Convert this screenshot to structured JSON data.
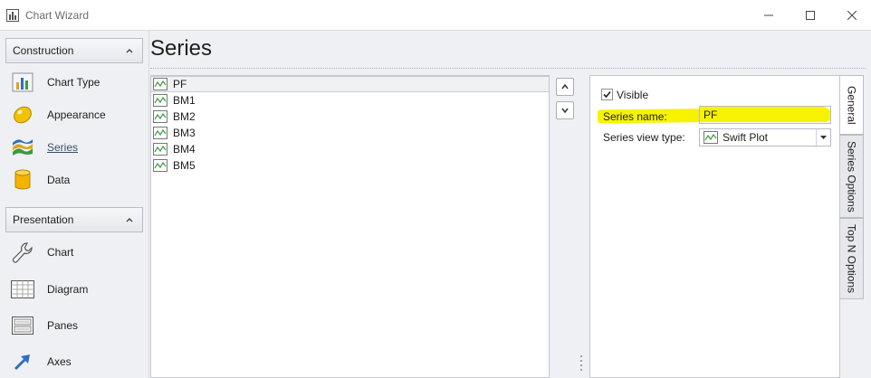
{
  "window": {
    "title": "Chart Wizard",
    "icon": "chart-wizard-icon"
  },
  "sidebar": {
    "groups": [
      {
        "label": "Construction",
        "items": [
          {
            "label": "Chart Type",
            "icon": "chart-type-icon"
          },
          {
            "label": "Appearance",
            "icon": "appearance-icon"
          },
          {
            "label": "Series",
            "icon": "series-icon",
            "active": true
          },
          {
            "label": "Data",
            "icon": "data-icon"
          }
        ]
      },
      {
        "label": "Presentation",
        "items": [
          {
            "label": "Chart",
            "icon": "wrench-icon"
          },
          {
            "label": "Diagram",
            "icon": "diagram-icon"
          },
          {
            "label": "Panes",
            "icon": "panes-icon"
          },
          {
            "label": "Axes",
            "icon": "axes-icon"
          }
        ]
      }
    ]
  },
  "main": {
    "title": "Series",
    "series_list": [
      {
        "name": "PF",
        "selected": true
      },
      {
        "name": "BM1"
      },
      {
        "name": "BM2"
      },
      {
        "name": "BM3"
      },
      {
        "name": "BM4"
      },
      {
        "name": "BM5"
      }
    ]
  },
  "properties": {
    "visible_label": "Visible",
    "visible_checked": true,
    "series_name_label": "Series name:",
    "series_name_value": "PF",
    "view_type_label": "Series view type:",
    "view_type_value": "Swift Plot"
  },
  "tabs": [
    {
      "label": "General",
      "active": true
    },
    {
      "label": "Series Options"
    },
    {
      "label": "Top N Options"
    }
  ],
  "colors": {
    "highlight": "#f7f300",
    "accent": "#2f6fbf"
  }
}
